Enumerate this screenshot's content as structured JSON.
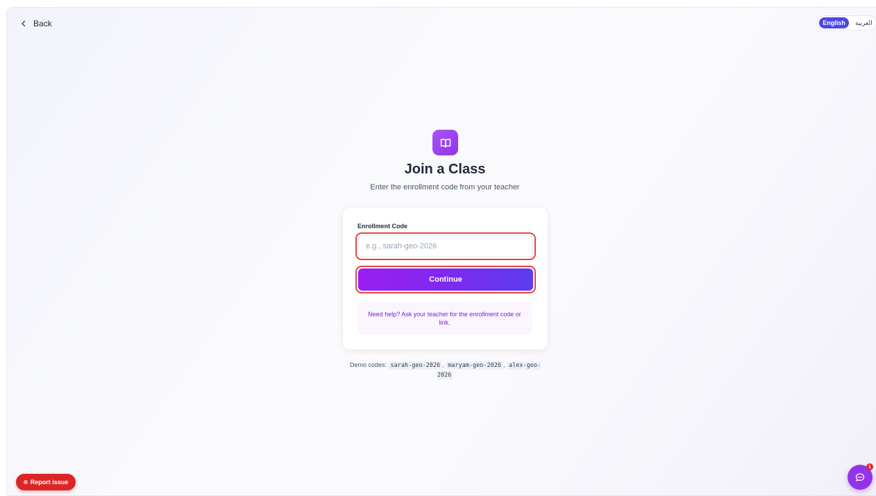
{
  "nav": {
    "back_label": "Back"
  },
  "language": {
    "active": "English",
    "inactive": "العربية"
  },
  "header": {
    "title": "Join a Class",
    "subtitle": "Enter the enrollment code from your teacher"
  },
  "form": {
    "field_label": "Enrollment Code",
    "input_value": "",
    "input_placeholder": "e.g., sarah-geo-2026",
    "submit_label": "Continue",
    "help_text": "Need help? Ask your teacher for the enrollment code or link."
  },
  "demo": {
    "prefix": "Demo codes:",
    "codes": [
      "sarah-geo-2026",
      "maryam-geo-2026",
      "alex-geo-2026"
    ],
    "separator": ","
  },
  "footer": {
    "report_label": "Report issue",
    "chat_badge": "1"
  },
  "icons": {
    "back": "chevron-left-icon",
    "logo": "book-open-icon",
    "report": "bug-icon",
    "chat": "chat-bubble-icon"
  },
  "colors": {
    "accent": "#9333ea",
    "button_gradient_start": "#9b1ef2",
    "button_gradient_end": "#5b3cf0",
    "highlight_ring": "#e0463f",
    "report": "#dc2626",
    "language_active": "#4f46e5"
  }
}
